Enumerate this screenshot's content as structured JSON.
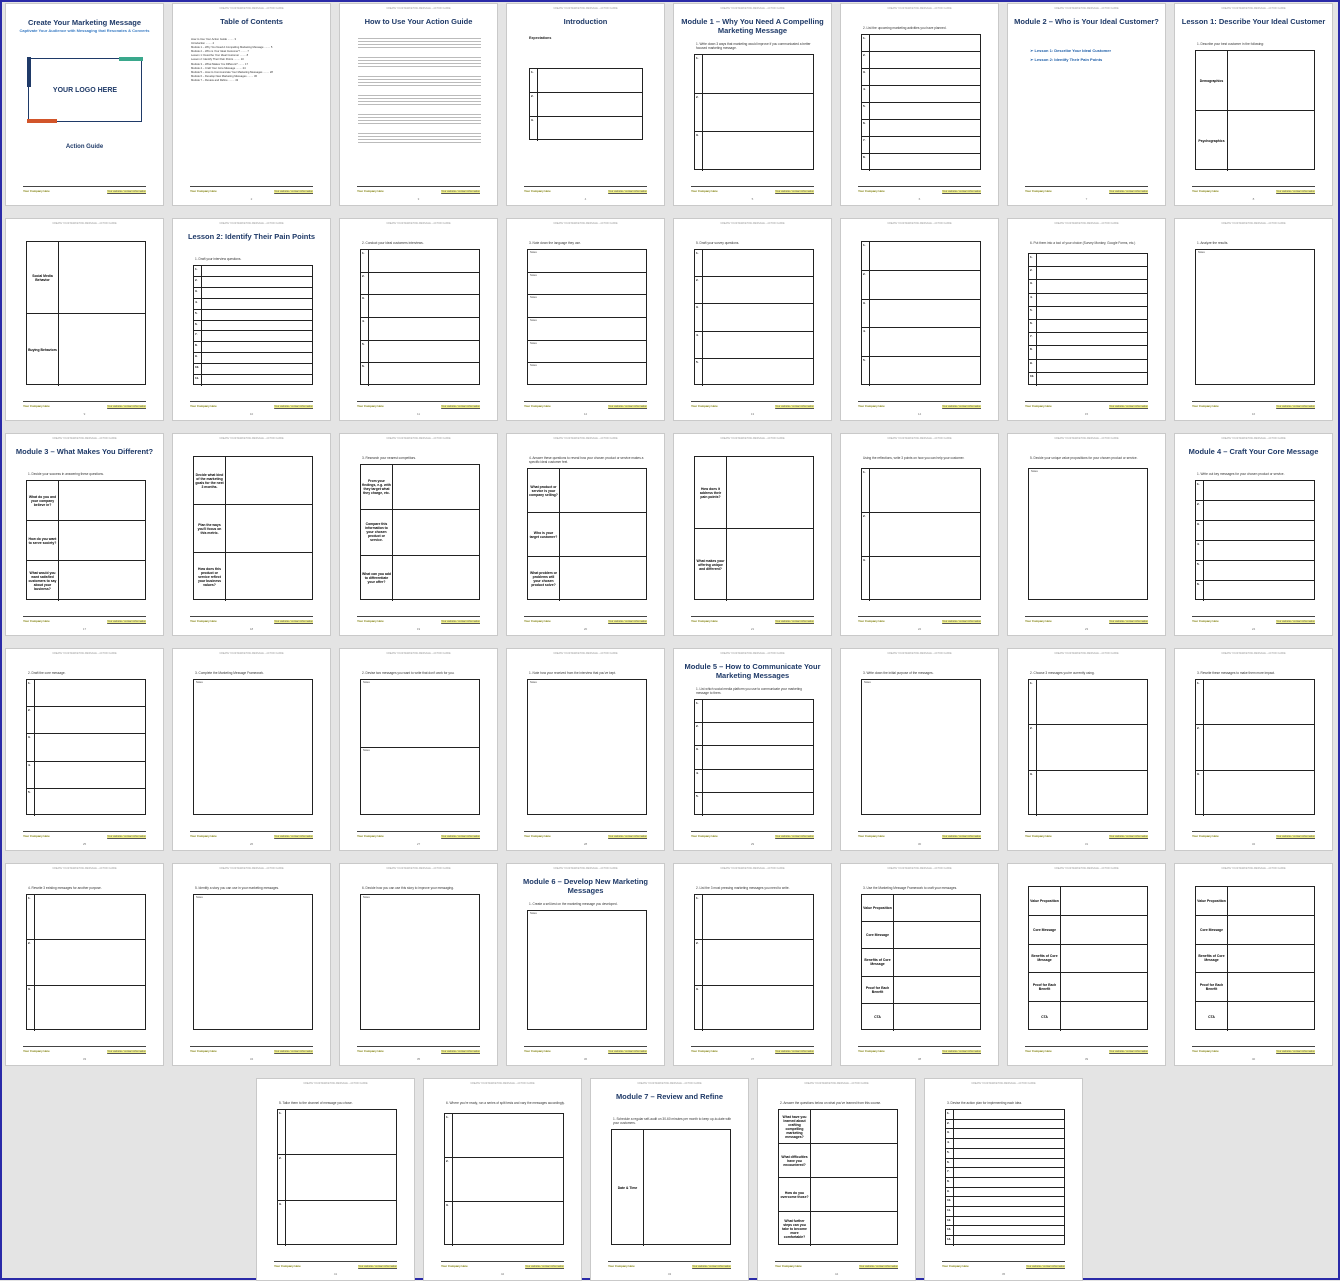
{
  "app": {
    "title": "Action Guide workbook page overview"
  },
  "header_text": "CREATE YOUR MARKETING MESSAGE – ACTION GUIDE",
  "footer": {
    "left": "Your Company Here",
    "right": "Your website / contact information"
  },
  "pages": [
    {
      "type": "cover",
      "title": "Create Your Marketing Message",
      "subtitle": "Captivate Your Audience with Messaging that Resonates & Converts",
      "logo": "YOUR LOGO HERE",
      "bottom": "Action Guide",
      "num": ""
    },
    {
      "type": "toc",
      "title": "Table of Contents",
      "items": [
        "How to Use Your Action Guide ........ 3",
        "Introduction ........ 4",
        "Module 1 – Why You Need A Compelling Marketing Message ........ 5",
        "Module 2 – Who is Your Ideal Customer? ........ 7",
        "Lesson 1: Describe Your Ideal Customer ........ 8",
        "Lesson 2: Identify Their Pain Points ........ 10",
        "Module 3 – What Makes You Different? ........ 17",
        "Module 4 – Craft Your Core Message ........ 24",
        "Module 5 – How to Communicate Your Marketing Messages ........ 28",
        "Module 6 – Develop New Marketing Messages ........ 36",
        "Module 7 – Review and Refine ........ 43"
      ],
      "num": "2"
    },
    {
      "type": "text",
      "title": "How to Use Your Action Guide",
      "num": "3"
    },
    {
      "type": "intro",
      "title": "Introduction",
      "sub": "Expectations",
      "num": "4"
    },
    {
      "type": "module",
      "title": "Module 1 – Why You Need A Compelling Marketing Message",
      "inst": "1. Write down 3 ways that marketing would improve if you communicated a better focused marketing message.",
      "rows": 3,
      "num": "5"
    },
    {
      "type": "list",
      "inst": "2. List the upcoming marketing activities you have planned.",
      "rows": 8,
      "num": "6"
    },
    {
      "type": "module2",
      "title": "Module 2 – Who is Your Ideal Customer?",
      "lessons": [
        "Lesson 1: Describe Your Ideal Customer",
        "Lesson 2: Identify Their Pain Points"
      ],
      "num": "7"
    },
    {
      "type": "labels",
      "title": "Lesson 1: Describe Your Ideal Customer",
      "inst": "1. Describe your best customer in the following:",
      "labels": [
        "Demographics",
        "Psychographics"
      ],
      "num": "8"
    },
    {
      "type": "labels",
      "title": "",
      "inst": "",
      "labels": [
        "Social Media Behavior",
        "Buying Behaviors"
      ],
      "num": "9"
    },
    {
      "type": "list",
      "title": "Lesson 2: Identify Their Pain Points",
      "inst": "1. Draft your interview questions.",
      "rows": 11,
      "num": "10"
    },
    {
      "type": "list",
      "inst": "2. Conduct your ideal customers interviews.",
      "rows": 6,
      "num": "11"
    },
    {
      "type": "notes",
      "inst": "3. Note down the language they use.",
      "rows": 6,
      "num": "12"
    },
    {
      "type": "list",
      "inst": "5. Draft your survey questions.",
      "rows": 5,
      "num": "13"
    },
    {
      "type": "list",
      "inst": "",
      "rows": 5,
      "num": "14"
    },
    {
      "type": "list",
      "inst": "6. Put them into a tool of your choice (Survey Monkey, Google Forms, etc.)",
      "rows": 10,
      "num": "15"
    },
    {
      "type": "notes",
      "inst": "1. Analyze the results.",
      "rows": 1,
      "num": "16"
    },
    {
      "type": "labels",
      "title": "Module 3 – What Makes You Different?",
      "inst": "1. Decide your success in answering these questions.",
      "labels": [
        "What do you and your company believe in?",
        "How do you want to serve society?",
        "What would you want satisfied customers to say about your business?"
      ],
      "num": "17"
    },
    {
      "type": "labels",
      "title": "",
      "inst": "",
      "labels": [
        "Decide what kind of the marketing goals for the next 3 months.",
        "Plan the ways you'll focus on this metric.",
        "How does this product or service reflect your business values?"
      ],
      "num": "18"
    },
    {
      "type": "labels",
      "title": "",
      "inst": "3. Research your nearest competitors.",
      "labels": [
        "From your findings, e.g. with they target what they charge, etc.",
        "Compare this information to your chosen product or service.",
        "What can you add to differentiate your offer?"
      ],
      "num": "19"
    },
    {
      "type": "labels",
      "title": "",
      "inst": "4. Answer these questions to reveal how your chosen product or service makes a specific ideal customer feel.",
      "labels": [
        "What product or service is your company selling?",
        "Who is your target customer?",
        "What problem or problems will your chosen product solve?"
      ],
      "num": "20"
    },
    {
      "type": "labels",
      "title": "",
      "inst": "",
      "labels": [
        "How does it address their pain points?",
        "What makes your offering unique and different?"
      ],
      "num": "21"
    },
    {
      "type": "list",
      "inst": "Using the reflections, write 3 points on how you can help your customer.",
      "rows": 3,
      "num": "22"
    },
    {
      "type": "notes",
      "inst": "5. Decide your unique value propositions for your chosen product or service.",
      "rows": 1,
      "num": "23"
    },
    {
      "type": "list",
      "title": "Module 4 – Craft Your Core Message",
      "inst": "1. Write out key messages for your chosen product or service.",
      "rows": 6,
      "num": "24"
    },
    {
      "type": "list",
      "inst": "2. Draft the core message.",
      "rows": 5,
      "num": "25"
    },
    {
      "type": "notes",
      "inst": "3. Complete the Marketing Message Framework.",
      "rows": 1,
      "num": "26"
    },
    {
      "type": "notes",
      "inst": "2. Devise two messages you want to write that don't work for you.",
      "rows": 2,
      "num": "27"
    },
    {
      "type": "notes",
      "inst": "1. Note how your received from the interview that you've kept.",
      "rows": 1,
      "num": "28"
    },
    {
      "type": "list",
      "title": "Module 5 – How to Communicate Your Marketing Messages",
      "inst": "1. List which social media platform you use to communicate your marketing message to them.",
      "rows": 5,
      "num": "29"
    },
    {
      "type": "notes",
      "inst": "3. Write down the initial purpose of the messages.",
      "rows": 1,
      "num": "30"
    },
    {
      "type": "list",
      "inst": "2. Choose 3 messages you're currently using.",
      "rows": 3,
      "num": "31"
    },
    {
      "type": "list",
      "inst": "3. Rewrite these messages to make them more impact.",
      "rows": 3,
      "num": "32"
    },
    {
      "type": "list",
      "inst": "4. Rewrite 3 existing messages for another purpose.",
      "rows": 3,
      "num": "33"
    },
    {
      "type": "notes",
      "inst": "5. Identify a story you can use in your marketing messages.",
      "rows": 1,
      "num": "34"
    },
    {
      "type": "notes",
      "inst": "6. Decide how you can use this story to improve your messaging.",
      "rows": 1,
      "num": "35"
    },
    {
      "type": "notes",
      "title": "Module 6 – Develop New Marketing Messages",
      "inst": "1. Create a sell-test on the marketing message you developed.",
      "rows": 1,
      "num": "36"
    },
    {
      "type": "list",
      "inst": "2. List the 3 most pressing marketing messages you need to write.",
      "rows": 3,
      "num": "37"
    },
    {
      "type": "labels",
      "title": "",
      "inst": "3. Use the Marketing Message Framework to craft your messages.",
      "labels": [
        "Value Proposition",
        "Core Message",
        "Benefits of Core Message",
        "Proof for Each Benefit",
        "CTA"
      ],
      "num": "38"
    },
    {
      "type": "labels",
      "title": "",
      "inst": "",
      "labels": [
        "Value Proposition",
        "Core Message",
        "Benefits of Core Message",
        "Proof for Each Benefit",
        "CTA"
      ],
      "num": "39"
    },
    {
      "type": "labels",
      "title": "",
      "inst": "",
      "labels": [
        "Value Proposition",
        "Core Message",
        "Benefits of Core Message",
        "Proof for Each Benefit",
        "CTA"
      ],
      "num": "40"
    },
    {
      "type": "list",
      "inst": "5. Tailor them to the channel of message you chose.",
      "rows": 3,
      "num": "41"
    },
    {
      "type": "list",
      "inst": "6. Where you're ready, run a series of split tests and vary the messages accordingly.",
      "rows": 3,
      "num": "42"
    },
    {
      "type": "labels",
      "title": "Module 7 – Review and Refine",
      "inst": "1. Schedule a regular self-audit on 30-60 minutes per month to keep up-to-date with your customers.",
      "labels": [
        "Date & Time"
      ],
      "num": "43"
    },
    {
      "type": "labels",
      "title": "",
      "inst": "2. Answer the questions below on what you've learned from this course.",
      "labels": [
        "What have you learned about crafting compelling marketing messages?",
        "What difficulties have you encountered?",
        "How do you overcome those?",
        "What further steps can you take to become more comfortable?"
      ],
      "num": "44"
    },
    {
      "type": "list",
      "inst": "3. Devise the action plan for implementing each idea.",
      "rows": 14,
      "num": "45"
    }
  ]
}
